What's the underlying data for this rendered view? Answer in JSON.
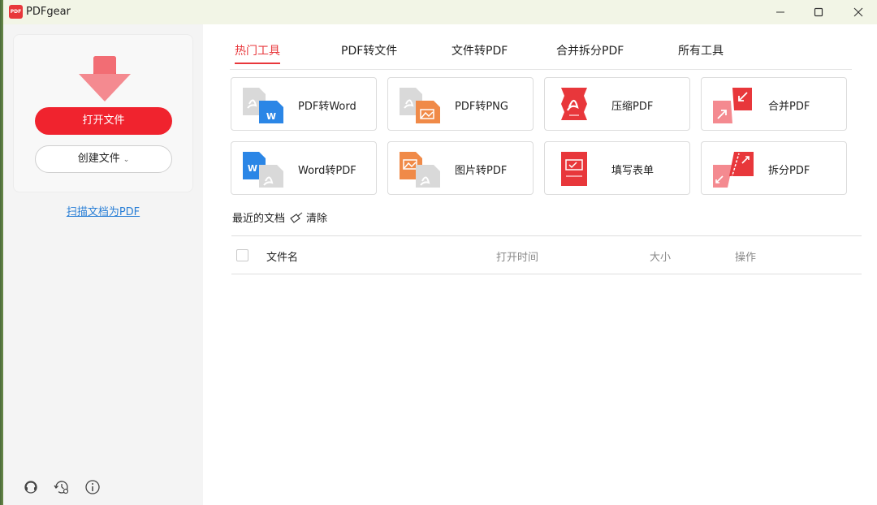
{
  "window": {
    "title": "PDFgear",
    "logo_text": "PDF",
    "buttons": [
      "minimize",
      "maximize",
      "close"
    ]
  },
  "sidebar": {
    "open_label": "打开文件",
    "create_label": "创建文件",
    "create_chevron": "⌄",
    "scan_label": "扫描文档为PDF",
    "bottom_icons": [
      "support-icon",
      "history-settings-icon",
      "info-icon"
    ]
  },
  "tabs": [
    {
      "label": "热门工具",
      "active": true
    },
    {
      "label": "PDF转文件",
      "active": false
    },
    {
      "label": "文件转PDF",
      "active": false
    },
    {
      "label": "合并拆分PDF",
      "active": false
    },
    {
      "label": "所有工具",
      "active": false
    }
  ],
  "tools": [
    {
      "label": "PDF转Word",
      "icon": "pdf-to-word-icon"
    },
    {
      "label": "PDF转PNG",
      "icon": "pdf-to-png-icon"
    },
    {
      "label": "压缩PDF",
      "icon": "compress-pdf-icon"
    },
    {
      "label": "合并PDF",
      "icon": "merge-pdf-icon"
    },
    {
      "label": "Word转PDF",
      "icon": "word-to-pdf-icon"
    },
    {
      "label": "图片转PDF",
      "icon": "image-to-pdf-icon"
    },
    {
      "label": "填写表单",
      "icon": "fill-form-icon"
    },
    {
      "label": "拆分PDF",
      "icon": "split-pdf-icon"
    }
  ],
  "recent": {
    "title": "最近的文档",
    "clear_label": "清除",
    "columns": {
      "name": "文件名",
      "time": "打开时间",
      "size": "大小",
      "action": "操作"
    }
  },
  "colors": {
    "accent": "#e8373b",
    "link": "#2a7fd6",
    "word_blue": "#2b86e6",
    "image_orange": "#f08a48"
  }
}
